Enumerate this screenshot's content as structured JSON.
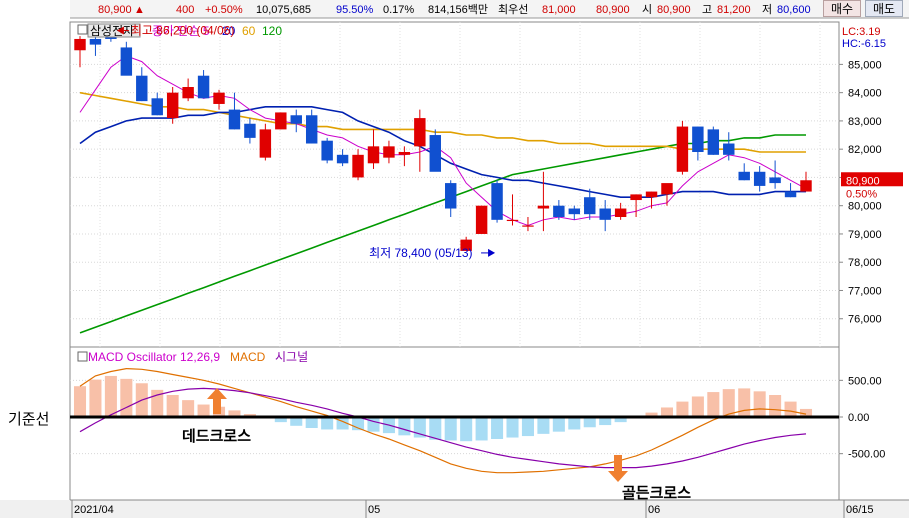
{
  "ticker": {
    "price": "80,900",
    "change": "400",
    "change_pct": "+0.50%",
    "volume": "10,075,685",
    "vol_pct": "95.50%",
    "turnover_pct": "0.17%",
    "amount": "814,156백만",
    "best_label": "최우선",
    "best_ask": "81,000",
    "best_bid": "80,900",
    "open_label": "시",
    "open": "80,900",
    "high_label": "고",
    "high": "81,200",
    "low_label": "저",
    "low": "80,600",
    "buy_label": "매수",
    "sell_label": "매도"
  },
  "side_label": "기준선",
  "chart_data": [
    {
      "type": "candlestick",
      "title": "삼성전자",
      "legend": [
        {
          "label": "종가 단순 5",
          "color": "#cc00cc"
        },
        {
          "label": "20",
          "color": "#0000cc"
        },
        {
          "label": "60",
          "color": "#e0a000"
        },
        {
          "label": "120",
          "color": "#009900"
        }
      ],
      "ylim": [
        75000,
        86500
      ],
      "yticks": [
        "85,000",
        "84,000",
        "83,000",
        "82,000",
        "81,000",
        "80,000",
        "79,000",
        "78,000",
        "77,000",
        "76,000"
      ],
      "ytick_values": [
        85000,
        84000,
        83000,
        82000,
        81000,
        80000,
        79000,
        78000,
        77000,
        76000
      ],
      "lc_label": "LC:3.19",
      "hc_label": "HC:-6.15",
      "last_price_label": "80,900",
      "last_pct_label": "0.50%",
      "annotations": {
        "max": {
          "text": "최고 86,200 (04/06)",
          "index": 2,
          "price": 86200
        },
        "min": {
          "text": "최저 78,400 (05/13)",
          "index": 27,
          "price": 78400
        }
      },
      "candles": [
        {
          "o": 85500,
          "h": 86000,
          "l": 84900,
          "c": 85900
        },
        {
          "o": 85900,
          "h": 86000,
          "l": 85300,
          "c": 85700
        },
        {
          "o": 86000,
          "h": 86200,
          "l": 85800,
          "c": 85900
        },
        {
          "o": 85600,
          "h": 85800,
          "l": 84900,
          "c": 84600
        },
        {
          "o": 84600,
          "h": 84900,
          "l": 83700,
          "c": 83700
        },
        {
          "o": 83800,
          "h": 84000,
          "l": 83200,
          "c": 83200
        },
        {
          "o": 83100,
          "h": 84200,
          "l": 82900,
          "c": 84000
        },
        {
          "o": 83800,
          "h": 84500,
          "l": 83700,
          "c": 84200
        },
        {
          "o": 84600,
          "h": 84800,
          "l": 83800,
          "c": 83800
        },
        {
          "o": 83600,
          "h": 84100,
          "l": 83400,
          "c": 84000
        },
        {
          "o": 83400,
          "h": 84000,
          "l": 82700,
          "c": 82700
        },
        {
          "o": 82900,
          "h": 83100,
          "l": 82200,
          "c": 82400
        },
        {
          "o": 81700,
          "h": 82900,
          "l": 81600,
          "c": 82700
        },
        {
          "o": 82700,
          "h": 83300,
          "l": 82700,
          "c": 83300
        },
        {
          "o": 83200,
          "h": 83400,
          "l": 82600,
          "c": 82900
        },
        {
          "o": 83200,
          "h": 83400,
          "l": 82200,
          "c": 82200
        },
        {
          "o": 82300,
          "h": 82400,
          "l": 81500,
          "c": 81600
        },
        {
          "o": 81800,
          "h": 82000,
          "l": 81400,
          "c": 81500
        },
        {
          "o": 81000,
          "h": 82000,
          "l": 80900,
          "c": 81800
        },
        {
          "o": 81500,
          "h": 82700,
          "l": 81300,
          "c": 82100
        },
        {
          "o": 81700,
          "h": 82300,
          "l": 81500,
          "c": 82100
        },
        {
          "o": 81800,
          "h": 82100,
          "l": 81400,
          "c": 81900
        },
        {
          "o": 82100,
          "h": 83400,
          "l": 81200,
          "c": 83100
        },
        {
          "o": 82500,
          "h": 82700,
          "l": 81300,
          "c": 81200
        },
        {
          "o": 80800,
          "h": 80900,
          "l": 79600,
          "c": 79900
        },
        {
          "o": 78400,
          "h": 78900,
          "l": 78400,
          "c": 78800
        },
        {
          "o": 79000,
          "h": 80000,
          "l": 79000,
          "c": 80000
        },
        {
          "o": 80800,
          "h": 80900,
          "l": 79400,
          "c": 79500
        },
        {
          "o": 79500,
          "h": 80400,
          "l": 79300,
          "c": 79500
        },
        {
          "o": 79300,
          "h": 79600,
          "l": 79100,
          "c": 79300
        },
        {
          "o": 79900,
          "h": 81200,
          "l": 79100,
          "c": 80000
        },
        {
          "o": 80000,
          "h": 80200,
          "l": 79500,
          "c": 79600
        },
        {
          "o": 79900,
          "h": 80000,
          "l": 79500,
          "c": 79700
        },
        {
          "o": 80300,
          "h": 80600,
          "l": 79500,
          "c": 79700
        },
        {
          "o": 79900,
          "h": 80200,
          "l": 79100,
          "c": 79500
        },
        {
          "o": 79600,
          "h": 80100,
          "l": 79500,
          "c": 79900
        },
        {
          "o": 80200,
          "h": 80400,
          "l": 79600,
          "c": 80400
        },
        {
          "o": 80300,
          "h": 80500,
          "l": 79900,
          "c": 80500
        },
        {
          "o": 80400,
          "h": 80700,
          "l": 80000,
          "c": 80800
        },
        {
          "o": 81200,
          "h": 83000,
          "l": 81100,
          "c": 82800
        },
        {
          "o": 82800,
          "h": 82800,
          "l": 81600,
          "c": 81900
        },
        {
          "o": 82700,
          "h": 82800,
          "l": 81800,
          "c": 81800
        },
        {
          "o": 82200,
          "h": 82600,
          "l": 81600,
          "c": 81800
        },
        {
          "o": 81200,
          "h": 81500,
          "l": 80900,
          "c": 80900
        },
        {
          "o": 81200,
          "h": 81400,
          "l": 80500,
          "c": 80700
        },
        {
          "o": 81000,
          "h": 81600,
          "l": 80600,
          "c": 80800
        },
        {
          "o": 80500,
          "h": 80800,
          "l": 80300,
          "c": 80300
        },
        {
          "o": 80500,
          "h": 81200,
          "l": 80600,
          "c": 80900
        }
      ],
      "ma5": [
        83300,
        84100,
        84900,
        85300,
        85100,
        84600,
        84300,
        84000,
        83800,
        83900,
        83800,
        83400,
        83100,
        83000,
        82900,
        82700,
        82500,
        82400,
        82100,
        81900,
        81800,
        81800,
        81900,
        82100,
        81700,
        80800,
        80300,
        79800,
        79500,
        79300,
        79500,
        79600,
        79500,
        79600,
        79600,
        79700,
        79800,
        80000,
        80100,
        80700,
        81200,
        81500,
        81800,
        81700,
        81500,
        81200,
        80900,
        80600
      ],
      "ma20": [
        82200,
        82600,
        82800,
        83000,
        83100,
        83100,
        83100,
        83200,
        83200,
        83300,
        83300,
        83400,
        83500,
        83500,
        83500,
        83500,
        83400,
        83300,
        83000,
        82800,
        82600,
        82300,
        82100,
        81800,
        81500,
        81300,
        81100,
        81000,
        80900,
        80900,
        80800,
        80700,
        80600,
        80500,
        80400,
        80300,
        80300,
        80300,
        80400,
        80500,
        80500,
        80500,
        80400,
        80400,
        80400,
        80500,
        80500,
        80500
      ],
      "ma60": [
        84000,
        83900,
        83800,
        83700,
        83600,
        83500,
        83500,
        83400,
        83400,
        83300,
        83200,
        83100,
        83000,
        82900,
        82900,
        82800,
        82800,
        82700,
        82700,
        82700,
        82700,
        82700,
        82700,
        82600,
        82600,
        82500,
        82500,
        82400,
        82400,
        82300,
        82300,
        82200,
        82200,
        82200,
        82100,
        82100,
        82100,
        82100,
        82100,
        82000,
        82000,
        82000,
        82000,
        82000,
        81900,
        81900,
        81900,
        81900
      ],
      "ma120": [
        75500,
        75700,
        75900,
        76100,
        76300,
        76500,
        76700,
        76900,
        77100,
        77300,
        77500,
        77700,
        77900,
        78100,
        78300,
        78500,
        78700,
        78900,
        79100,
        79300,
        79500,
        79700,
        79900,
        80100,
        80300,
        80500,
        80700,
        80900,
        81100,
        81200,
        81300,
        81400,
        81500,
        81600,
        81700,
        81800,
        81900,
        82000,
        82100,
        82200,
        82200,
        82300,
        82300,
        82400,
        82400,
        82500,
        82500,
        82500
      ]
    },
    {
      "type": "bar+line",
      "title": "MACD Oscillator 12,26,9",
      "legend": [
        {
          "label": "MACD Oscillator 12,26,9",
          "color": "#cc00cc"
        },
        {
          "label": "MACD",
          "color": "#e07000"
        },
        {
          "label": "시그널",
          "color": "#8800aa"
        }
      ],
      "ylim": [
        -900,
        900
      ],
      "yticks": [
        "500.00",
        "0.00",
        "-500.00"
      ],
      "ytick_values": [
        500,
        0,
        -500
      ],
      "oscillator": [
        420,
        510,
        560,
        520,
        460,
        370,
        300,
        230,
        170,
        140,
        90,
        40,
        -10,
        -70,
        -120,
        -150,
        -170,
        -170,
        -180,
        -200,
        -220,
        -250,
        -280,
        -310,
        -320,
        -330,
        -320,
        -300,
        -280,
        -260,
        -230,
        -200,
        -170,
        -140,
        -110,
        -70,
        -20,
        60,
        130,
        210,
        280,
        340,
        380,
        390,
        350,
        300,
        210,
        110,
        50
      ],
      "macd": [
        420,
        560,
        620,
        660,
        650,
        620,
        580,
        540,
        500,
        450,
        390,
        330,
        270,
        210,
        140,
        80,
        20,
        -60,
        -150,
        -230,
        -300,
        -380,
        -460,
        -550,
        -640,
        -700,
        -740,
        -760,
        -760,
        -750,
        -740,
        -720,
        -700,
        -680,
        -640,
        -590,
        -530,
        -450,
        -350,
        -250,
        -140,
        -40,
        40,
        90,
        110,
        100,
        80,
        40,
        10
      ],
      "signal": [
        -200,
        -80,
        30,
        130,
        230,
        300,
        350,
        380,
        390,
        380,
        360,
        330,
        290,
        250,
        200,
        160,
        110,
        50,
        0,
        -60,
        -110,
        -170,
        -230,
        -290,
        -350,
        -410,
        -460,
        -510,
        -550,
        -580,
        -610,
        -640,
        -660,
        -680,
        -690,
        -690,
        -690,
        -670,
        -640,
        -600,
        -550,
        -490,
        -430,
        -370,
        -320,
        -280,
        -250,
        -230,
        -210
      ],
      "zero_label": "0.00",
      "annotations": {
        "dead_cross": "데드크로스",
        "golden_cross": "골든크로스"
      }
    }
  ],
  "x_axis": {
    "labels": [
      "2021/04",
      "05",
      "06",
      "06/15"
    ]
  }
}
